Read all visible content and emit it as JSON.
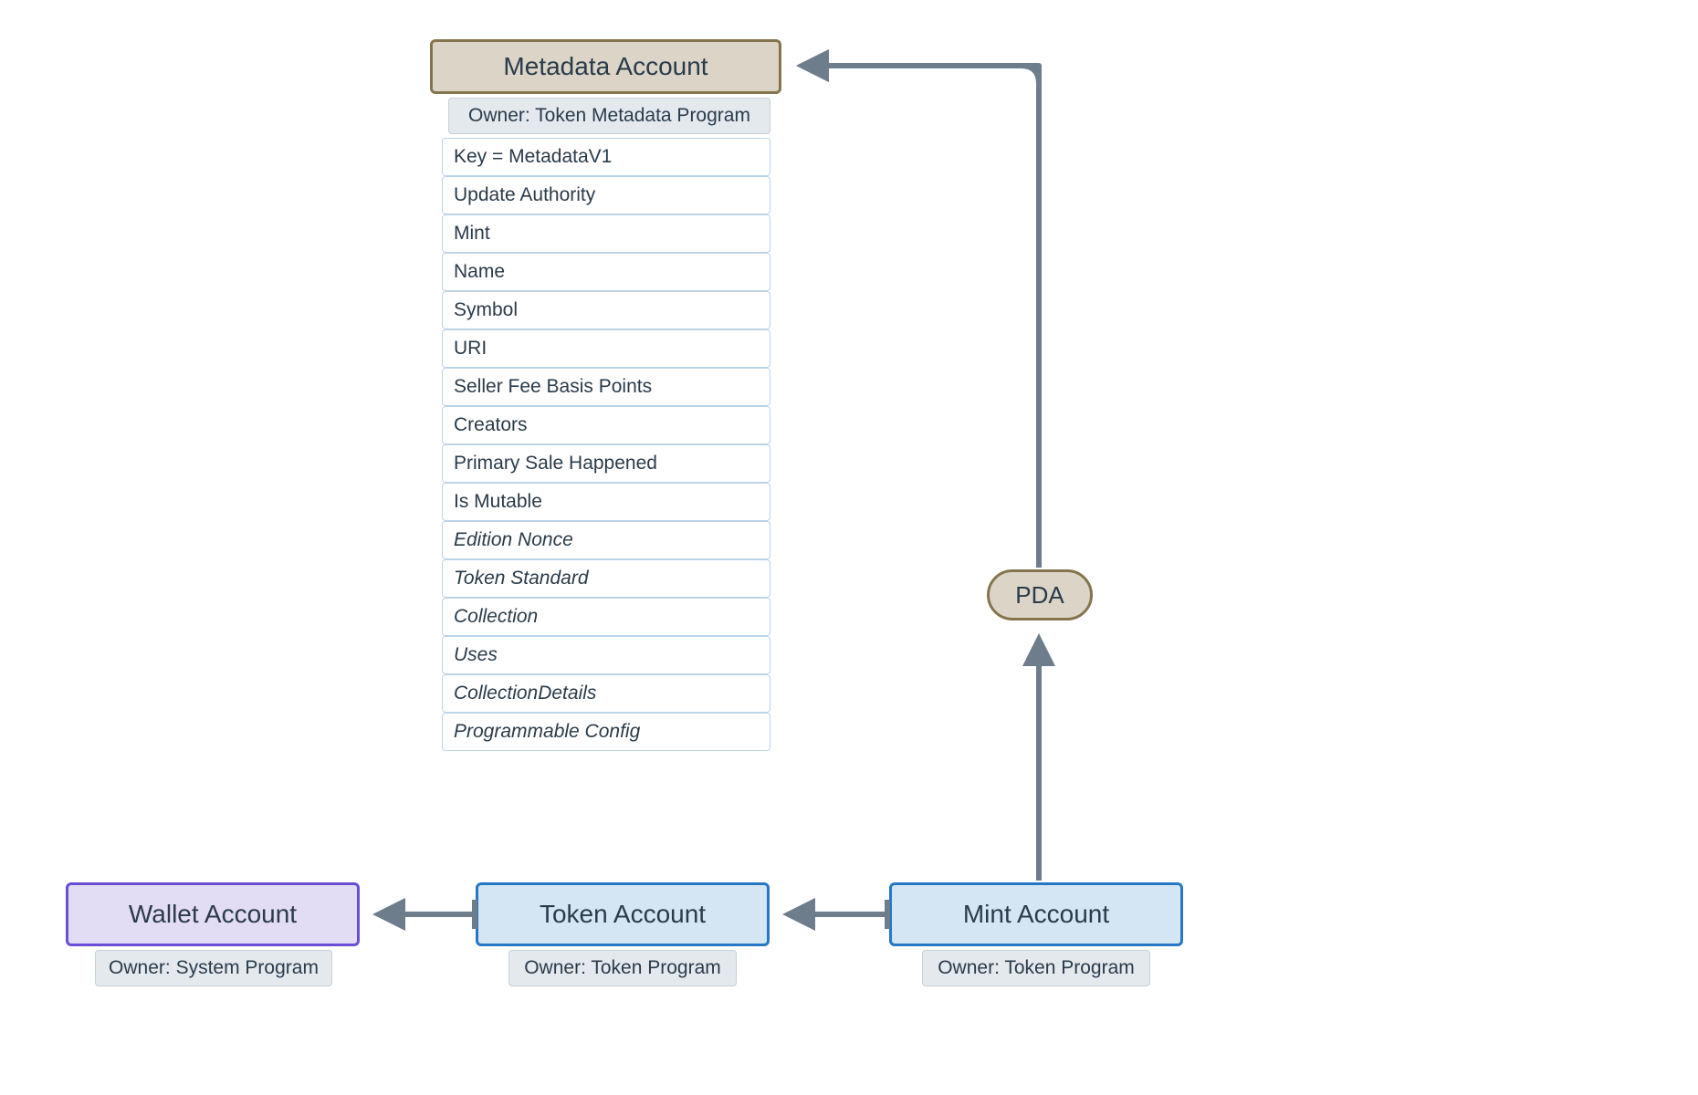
{
  "metadata": {
    "title": "Metadata Account",
    "owner": "Owner: Token Metadata Program",
    "fields": [
      {
        "text": "Key = MetadataV1",
        "italic": false
      },
      {
        "text": "Update Authority",
        "italic": false
      },
      {
        "text": "Mint",
        "italic": false
      },
      {
        "text": "Name",
        "italic": false
      },
      {
        "text": "Symbol",
        "italic": false
      },
      {
        "text": "URI",
        "italic": false
      },
      {
        "text": "Seller Fee Basis Points",
        "italic": false
      },
      {
        "text": "Creators",
        "italic": false
      },
      {
        "text": "Primary Sale Happened",
        "italic": false
      },
      {
        "text": "Is Mutable",
        "italic": false
      },
      {
        "text": "Edition Nonce",
        "italic": true
      },
      {
        "text": "Token Standard",
        "italic": true
      },
      {
        "text": "Collection",
        "italic": true
      },
      {
        "text": "Uses",
        "italic": true
      },
      {
        "text": "CollectionDetails",
        "italic": true
      },
      {
        "text": "Programmable Config",
        "italic": true
      }
    ]
  },
  "wallet": {
    "title": "Wallet Account",
    "owner": "Owner: System Program"
  },
  "token": {
    "title": "Token Account",
    "owner": "Owner: Token Program"
  },
  "mint": {
    "title": "Mint Account",
    "owner": "Owner: Token Program"
  },
  "pda": {
    "label": "PDA"
  }
}
